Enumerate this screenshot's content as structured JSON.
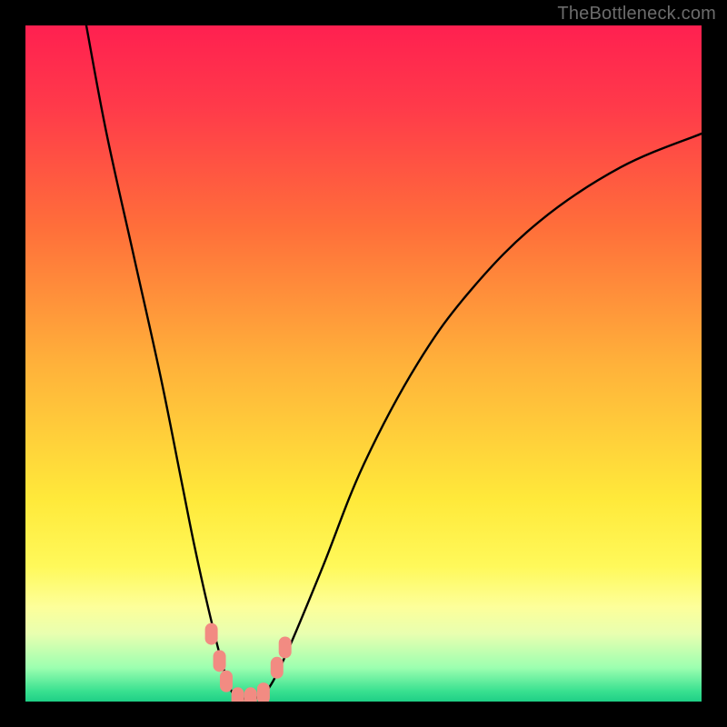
{
  "watermark": "TheBottleneck.com",
  "chart_data": {
    "type": "line",
    "title": "",
    "xlabel": "",
    "ylabel": "",
    "xlim": [
      0,
      100
    ],
    "ylim": [
      0,
      100
    ],
    "background_gradient": {
      "stops": [
        {
          "offset": 0.0,
          "color": "#ff2050"
        },
        {
          "offset": 0.12,
          "color": "#ff3a4a"
        },
        {
          "offset": 0.3,
          "color": "#ff6f3a"
        },
        {
          "offset": 0.5,
          "color": "#ffb13a"
        },
        {
          "offset": 0.7,
          "color": "#ffe93a"
        },
        {
          "offset": 0.8,
          "color": "#fff95a"
        },
        {
          "offset": 0.86,
          "color": "#fdff9a"
        },
        {
          "offset": 0.9,
          "color": "#e8ffb0"
        },
        {
          "offset": 0.95,
          "color": "#9cffb0"
        },
        {
          "offset": 0.985,
          "color": "#38e090"
        },
        {
          "offset": 1.0,
          "color": "#1fcf86"
        }
      ]
    },
    "series": [
      {
        "name": "bottleneck-curve",
        "x": [
          9,
          12,
          16,
          20,
          23,
          25,
          27,
          29,
          30.5,
          32,
          34,
          36,
          39,
          44,
          50,
          58,
          66,
          76,
          88,
          100
        ],
        "y": [
          100,
          84,
          66,
          48,
          33,
          23,
          14,
          6,
          1.5,
          0.5,
          0.5,
          2,
          8,
          20,
          35,
          50,
          61,
          71,
          79,
          84
        ]
      }
    ],
    "markers": {
      "name": "highlight-points",
      "color": "#f28b82",
      "points": [
        {
          "x": 27.5,
          "y": 10
        },
        {
          "x": 28.7,
          "y": 6
        },
        {
          "x": 29.7,
          "y": 3
        },
        {
          "x": 31.4,
          "y": 0.5
        },
        {
          "x": 33.3,
          "y": 0.5
        },
        {
          "x": 35.2,
          "y": 1.2
        },
        {
          "x": 37.2,
          "y": 5
        },
        {
          "x": 38.4,
          "y": 8
        }
      ]
    }
  }
}
